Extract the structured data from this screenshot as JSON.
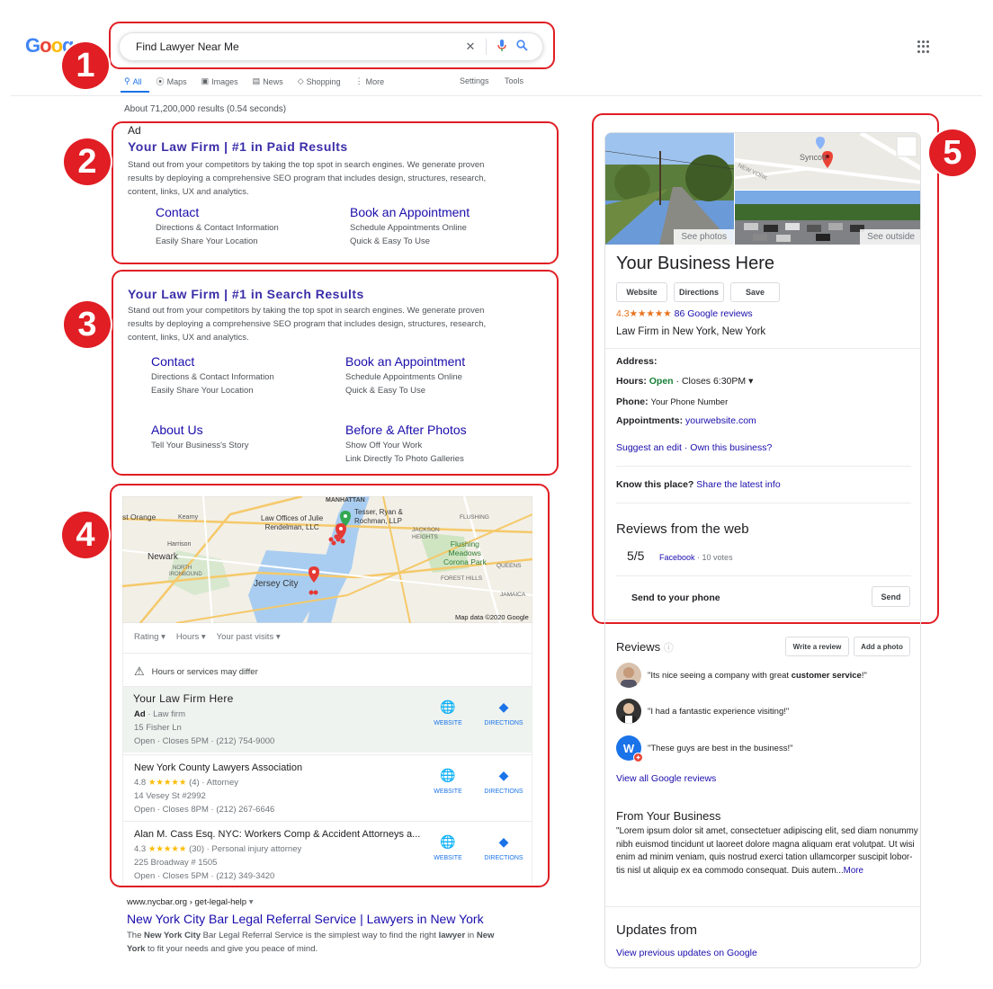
{
  "header": {
    "logo_letters": [
      "G",
      "o",
      "o",
      "g"
    ],
    "search_value": "Find Lawyer Near Me",
    "clear_icon": "close-icon",
    "mic_icon": "mic-icon",
    "search_icon": "search-icon",
    "apps_icon": "apps-grid-icon",
    "tabs": [
      {
        "label": "All",
        "icon": "search-icon"
      },
      {
        "label": "Maps",
        "icon": "map-pin-icon"
      },
      {
        "label": "Images",
        "icon": "image-icon"
      },
      {
        "label": "News",
        "icon": "news-icon"
      },
      {
        "label": "Shopping",
        "icon": "tag-icon"
      },
      {
        "label": "More",
        "icon": "more-icon"
      }
    ],
    "settings": "Settings",
    "tools": "Tools"
  },
  "results_stats": "About 71,200,000 results (0.54 seconds)",
  "badges": [
    "1",
    "2",
    "3",
    "4",
    "5"
  ],
  "ad": {
    "label": "Ad",
    "title": "Your Law Firm | #1 in Paid Results",
    "desc": [
      "Stand out from your competitors by taking the top spot in search engines. We generate proven",
      "results by deploying a comprehensive SEO program that includes design, structures, research,",
      "content, links, UX and analytics."
    ],
    "sitelinks": [
      {
        "title": "Contact",
        "lines": [
          "Directions & Contact Information",
          "Easily Share Your Location"
        ]
      },
      {
        "title": "Book an Appointment",
        "lines": [
          "Schedule Appointments Online",
          "Quick & Easy To Use"
        ]
      }
    ]
  },
  "organic": {
    "title": "Your Law Firm | #1 in Search Results",
    "desc": [
      "Stand out from your competitors by taking the top spot in search engines. We generate proven",
      "results by deploying a comprehensive SEO program that includes design, structures, research,",
      "content, links, UX and analytics."
    ],
    "sitelinks": [
      {
        "title": "Contact",
        "lines": [
          "Directions & Contact Information",
          "Easily Share Your Location"
        ]
      },
      {
        "title": "Book an Appointment",
        "lines": [
          "Schedule Appointments Online",
          "Quick & Easy To Use"
        ]
      },
      {
        "title": "About Us",
        "lines": [
          "Tell Your Business's Story"
        ]
      },
      {
        "title": "Before & After Photos",
        "lines": [
          "Show Off Your Work",
          "Link Directly To Photo Galleries"
        ]
      }
    ]
  },
  "local_pack": {
    "map_labels": [
      "MANHATTAN",
      "st Orange",
      "Kearny",
      "Harrison",
      "Newark",
      "NORTH",
      "IRONBOUND",
      "Jersey City",
      "Law Offices of Julie",
      "Rendelman, LLC",
      "Tesser, Ryan &",
      "Rochman, LLP",
      "FLUSHING",
      "JACKSON",
      "HEIGHTS",
      "Flushing",
      "Meadows",
      "Corona Park",
      "QUEENS",
      "FOREST HILLS",
      "JAMAICA"
    ],
    "map_credit": "Map data ©2020 Google",
    "filters": [
      "Rating",
      "Hours",
      "Your past visits"
    ],
    "warning": "Hours or services may differ",
    "listings": [
      {
        "title": "Your Law  Firm Here",
        "line1_ad": "Ad",
        "line1_rest": " · Law firm",
        "line2": "15 Fisher Ln",
        "line3": "Open · Closes 5PM · (212) 754-9000",
        "website": "WEBSITE",
        "directions": "DIRECTIONS"
      },
      {
        "title": "New York County Lawyers Association",
        "rating": "4.8",
        "stars": "★★★★★",
        "rest": "(4) · Attorney",
        "line2": "14 Vesey St #2992",
        "line3": "Open · Closes 8PM · (212) 267-6646",
        "website": "WEBSITE",
        "directions": "DIRECTIONS"
      },
      {
        "title": "Alan M. Cass Esq. NYC: Workers Comp & Accident Attorneys a...",
        "rating": "4.3",
        "stars": "★★★★★",
        "rest": "(30) · Personal injury attorney",
        "line2": "225 Broadway # 1505",
        "line3": "Open · Closes 5PM · (212) 349-3420",
        "website": "WEBSITE",
        "directions": "DIRECTIONS"
      }
    ]
  },
  "nycbar": {
    "url": "www.nycbar.org › get-legal-help",
    "title": "New York City Bar Legal Referral Service | Lawyers in New York",
    "desc_parts": [
      "The ",
      "New York City",
      " Bar Legal Referral Service is the simplest way to find the right ",
      "lawyer",
      " in ",
      "New",
      "York",
      " to fit your needs and give you peace of mind."
    ]
  },
  "knowledge_panel": {
    "see_photos": "See photos",
    "see_outside": "See outside",
    "map_label": "Syncott",
    "map_road": "NEW YORK",
    "title": "Your Business Here",
    "buttons": [
      "Website",
      "Directions",
      "Save"
    ],
    "rating": "4.3",
    "stars": "★★★★★",
    "reviews_link": "86 Google reviews",
    "category": "Law Firm in New York, New York",
    "address_label": "Address:",
    "hours_label": "Hours:",
    "hours_open": "Open",
    "hours_rest": "· Closes 6:30PM",
    "phone_label": "Phone:",
    "phone_value": "Your Phone Number",
    "appt_label": "Appointments:",
    "appt_value": "yourwebsite.com",
    "suggest": "Suggest an edit · Own this business?",
    "know_label": "Know this place?",
    "know_link": "Share the latest info",
    "web_reviews_title": "Reviews from the web",
    "web_score": "5/5",
    "web_source": "Facebook",
    "web_votes": "· 10 votes",
    "send_label": "Send to your phone",
    "send_btn": "Send",
    "reviews_title": "Reviews",
    "write_review": "Write a review",
    "add_photo": "Add a photo",
    "reviews": [
      {
        "pre": "\"Its nice seeing a company with great ",
        "bold": "customer service",
        "post": "!\""
      },
      {
        "pre": "\"I had a fantastic experience visiting!\"",
        "bold": "",
        "post": ""
      },
      {
        "pre": "\"These guys are best in the business!\"",
        "bold": "",
        "post": ""
      }
    ],
    "avatar_letter": "W",
    "view_all": "View all Google reviews",
    "from_title": "From Your Business",
    "from_lines": [
      "\"Lorem ipsum dolor sit amet, consectetuer adipiscing elit, sed diam nonummy",
      "nibh euismod tincidunt ut laoreet dolore magna aliquam erat volutpat. Ut wisi",
      "enim ad minim veniam, quis nostrud exerci tation ullamcorper suscipit lobor-",
      "tis nisl ut aliquip ex ea commodo consequat. Duis autem..."
    ],
    "more": "More",
    "updates_title": "Updates from",
    "updates_link": "View previous updates on Google"
  }
}
